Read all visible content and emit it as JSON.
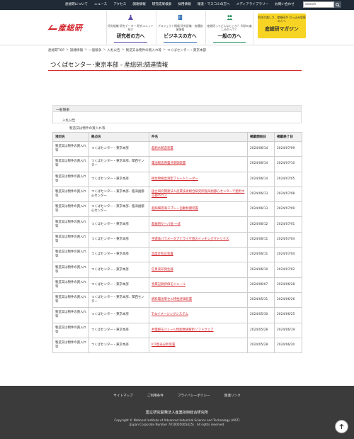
{
  "topnav": {
    "items": [
      "産総研について",
      "ニュース",
      "アクセス",
      "調達情報",
      "研究成果検索",
      "採用情報",
      "報道・マスコミの方へ",
      "メディアライブラリー",
      "お問い合わせ"
    ],
    "search_placeholder": "search"
  },
  "header": {
    "logo_text": "産総研",
    "nav": [
      {
        "sub": "研究組織 研究データー 研究ユニット紹介",
        "title": "研究者の方へ"
      },
      {
        "sub": "プロジェクト情報 研究設備・各種協業情報",
        "title": "ビジネスの方へ"
      },
      {
        "sub": "産総研ってどんなところ？ 科学の楽しみ方って？",
        "title": "一般の方へ"
      }
    ],
    "magazine": {
      "sub": "科学の楽しさ、産総研が 引っ込み思案の人へ",
      "title": "産総研マガジン"
    }
  },
  "breadcrumb": [
    "産総研TOP",
    "調達情報",
    "一般競争",
    "入札公告",
    "製造又は物件の買入れ等",
    "つくばセンター・東京本部"
  ],
  "page_title": "つくばセンター･東京本部 - 産総研:調達情報",
  "panel": {
    "head": "一般競争",
    "tree": [
      "入札公告",
      "製造又は物件の買入れ等",
      "つくばセンター・東京本部"
    ]
  },
  "table": {
    "headers": [
      "項目名",
      "拠点名",
      "件名",
      "掲載開始日",
      "掲載終了日"
    ],
    "rows": [
      [
        "製造又は物件の買入れ等",
        "つくばセンター・東京本部",
        "超純水製造装置",
        "2024/06/14",
        "2024/07/09"
      ],
      [
        "製造又は物件の買入れ等",
        "つくばセンター・東京本部、関西センター",
        "電池製造用露点制御装置",
        "2024/06/14",
        "2024/07/10"
      ],
      [
        "製造又は物件の買入れ等",
        "つくばセンター・東京本部",
        "微生物検出測定プレートリーダー",
        "2024/06/14",
        "2024/07/05"
      ],
      [
        "製造又は物件の買入れ等",
        "つくばセンター・東京本部、臨海副都心センター",
        "国立研究開発法人産業技術総合研究所臨海副都心センターで使用する都市ガス",
        "2024/06/13",
        "2024/07/08"
      ],
      [
        "製造又は物件の買入れ等",
        "つくばセンター・東京本部、臨海副都心センター",
        "超純細液滴スプレー自動製膜装置",
        "2024/06/13",
        "2024/07/09"
      ],
      [
        "製造又は物件の買入れ等",
        "つくばセンター・東京本部",
        "無振用サーバ他 一式",
        "2024/06/12",
        "2024/07/01"
      ],
      [
        "製造又は物件の買入れ等",
        "つくばセンター・東京本部",
        "半導体パラメータアナライザ用スイッチングマトリクス",
        "2024/06/11",
        "2024/07/04"
      ],
      [
        "製造又は物件の買入れ等",
        "つくばセンター・東京本部",
        "温度計校正装置",
        "2024/06/11",
        "2024/07/04"
      ],
      [
        "製造又は物件の買入れ等",
        "つくばセンター・東京本部",
        "任意波形発生器",
        "2024/06/10",
        "2024/07/02"
      ],
      [
        "製造又は物件の買入れ等",
        "つくばセンター・東京本部",
        "金属記録評価モジュール",
        "2024/06/07",
        "2024/06/28"
      ],
      [
        "製造又は物件の買入れ等",
        "つくばセンター・東京本部、関西センター",
        "燃料電池単セル特性評価装置",
        "2024/05/31",
        "2024/06/26"
      ],
      [
        "製造又は物件の買入れ等",
        "つくばセンター・東京本部",
        "THzイメージングシステム",
        "2024/05/30",
        "2024/06/25"
      ],
      [
        "製造又は物件の買入れ等",
        "つくばセンター・東京本部",
        "共電解モジュール性能数値解析ソフトウェア",
        "2024/05/28",
        "2024/06/19"
      ],
      [
        "製造又は物件の買入れ等",
        "つくばセンター・東京本部",
        "ICP発光分析装置",
        "2024/05/28",
        "2024/06/20"
      ]
    ]
  },
  "footer": {
    "links": [
      "サイトマップ",
      "ご利用条件",
      "プライバシーポリシー",
      "関連リンク"
    ],
    "org": "国立研究開発法人産業技術総合研究所",
    "copyright": "Copyright © National Institute of Advanced Industrial Science and Technology (AIST)",
    "corp_number": "(Japan Corporate Number 7010005005425) . All rights reserved."
  },
  "colors": {
    "accent": "#d2232a",
    "magazine": "#f7d423",
    "footer": "#3b3b3b",
    "topbar": "#1f2a36"
  }
}
